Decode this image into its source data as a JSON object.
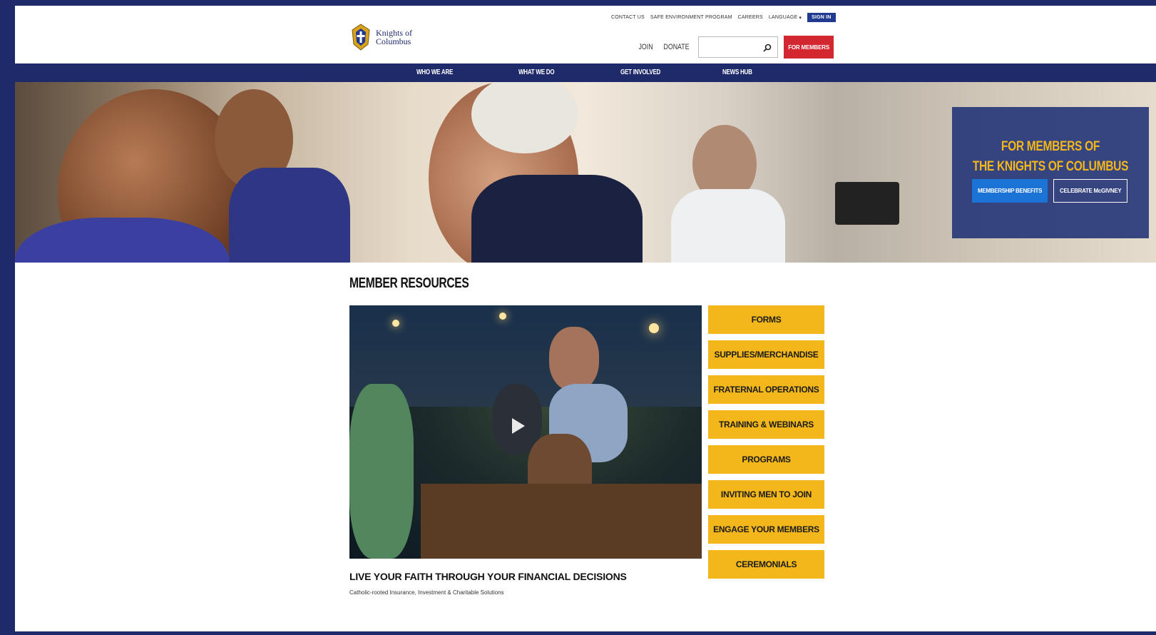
{
  "brand": {
    "logo_text_1": "Knights of",
    "logo_text_2": "Columbus"
  },
  "topnav": {
    "contact": "CONTACT US",
    "safe_env": "SAFE ENVIRONMENT PROGRAM",
    "careers": "CAREERS",
    "language": "LANGUAGE",
    "signin": "SIGN IN"
  },
  "header": {
    "join": "JOIN",
    "donate": "DONATE",
    "search_placeholder": "",
    "for_members": "FOR MEMBERS"
  },
  "mainnav": {
    "items": [
      "WHO WE ARE",
      "WHAT WE DO",
      "GET INVOLVED",
      "NEWS HUB"
    ]
  },
  "hero": {
    "title_1": "FOR MEMBERS OF",
    "title_2": "THE KNIGHTS OF COLUMBUS",
    "btn_benefits": "MEMBERSHIP BENEFITS",
    "btn_mcgivney": "CELEBRATE McGIVNEY"
  },
  "resources": {
    "title": "MEMBER RESOURCES",
    "video_heading": "LIVE YOUR FAITH THROUGH YOUR FINANCIAL DECISIONS",
    "video_sub": "Catholic-rooted Insurance, Investment & Charitable Solutions",
    "links": [
      "FORMS",
      "SUPPLIES/MERCHANDISE",
      "FRATERNAL OPERATIONS",
      "TRAINING & WEBINARS",
      "PROGRAMS",
      "INVITING MEN TO JOIN",
      "ENGAGE YOUR MEMBERS",
      "CEREMONIALS"
    ]
  },
  "colors": {
    "navy": "#1f2a6b",
    "red": "#d22630",
    "gold": "#f3b71c",
    "blue": "#1c73d6"
  }
}
